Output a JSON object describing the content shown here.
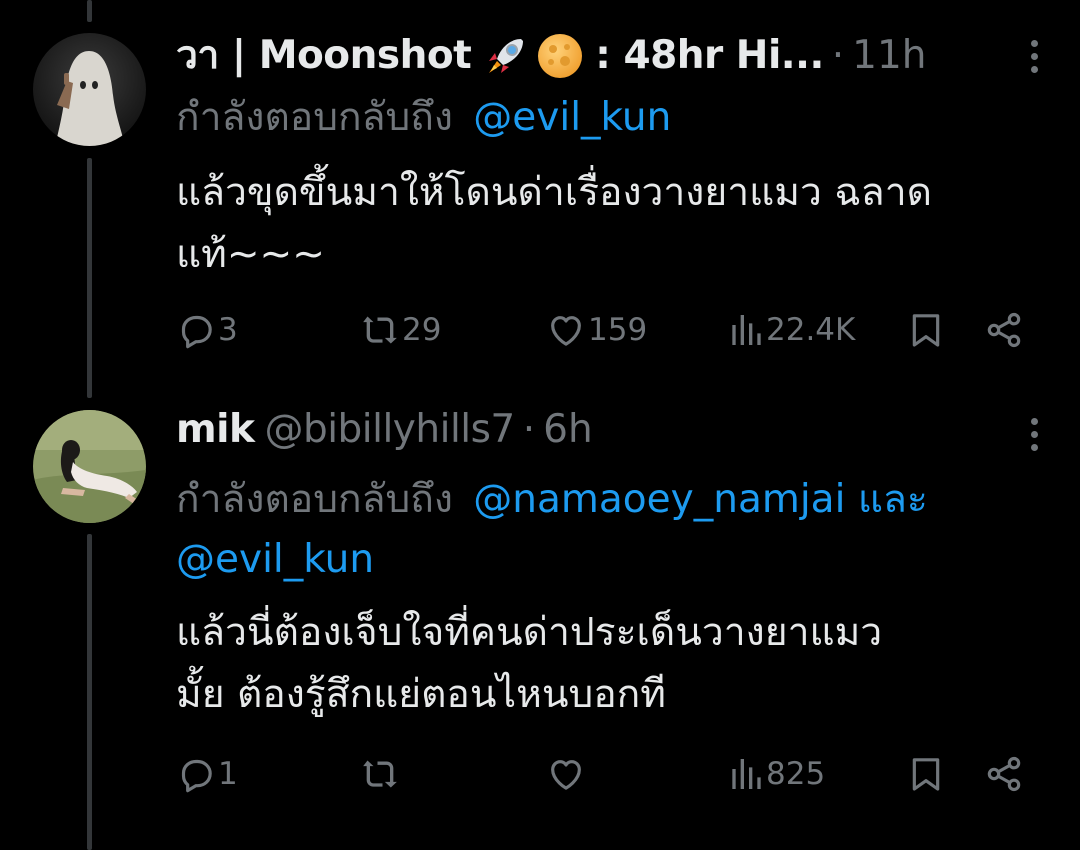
{
  "tweets": [
    {
      "display_name_prefix": "วา | Moonshot",
      "display_name_suffix": ": 48hr Hi...",
      "emojis": [
        "rocket-emoji",
        "full-moon-emoji"
      ],
      "handle": "",
      "dot": "·",
      "time": "11h",
      "reply_prefix": "กำลังตอบกลับถึง",
      "reply_mentions_line1": "@evil_kun",
      "reply_mentions_line2": "",
      "body_lines": [
        "แล้วขุดขึ้นมาให้โดนด่าเรื่องวางยาแมว ฉลาด",
        "แท้~~~"
      ],
      "replies": "3",
      "reposts": "29",
      "likes": "159",
      "views": "22.4K"
    },
    {
      "display_name_prefix": "mik",
      "display_name_suffix": "",
      "emojis": [],
      "handle": "@bibillyhills7",
      "dot": "·",
      "time": "6h",
      "reply_prefix": "กำลังตอบกลับถึง",
      "reply_mentions_line1": "@namaoey_namjai และ",
      "reply_mentions_line2": "@evil_kun",
      "body_lines": [
        "แล้วนี่ต้องเจ็บใจที่คนด่าประเด็นวางยาแมว",
        "มั้ย ต้องรู้สึกแย่ตอนไหนบอกที"
      ],
      "replies": "1",
      "reposts": "",
      "likes": "",
      "views": "825"
    }
  ],
  "colors": {
    "background": "#000000",
    "text_primary": "#e7e9ea",
    "text_secondary": "#71767b",
    "link": "#1d9bf0",
    "thread_line": "#333639"
  }
}
